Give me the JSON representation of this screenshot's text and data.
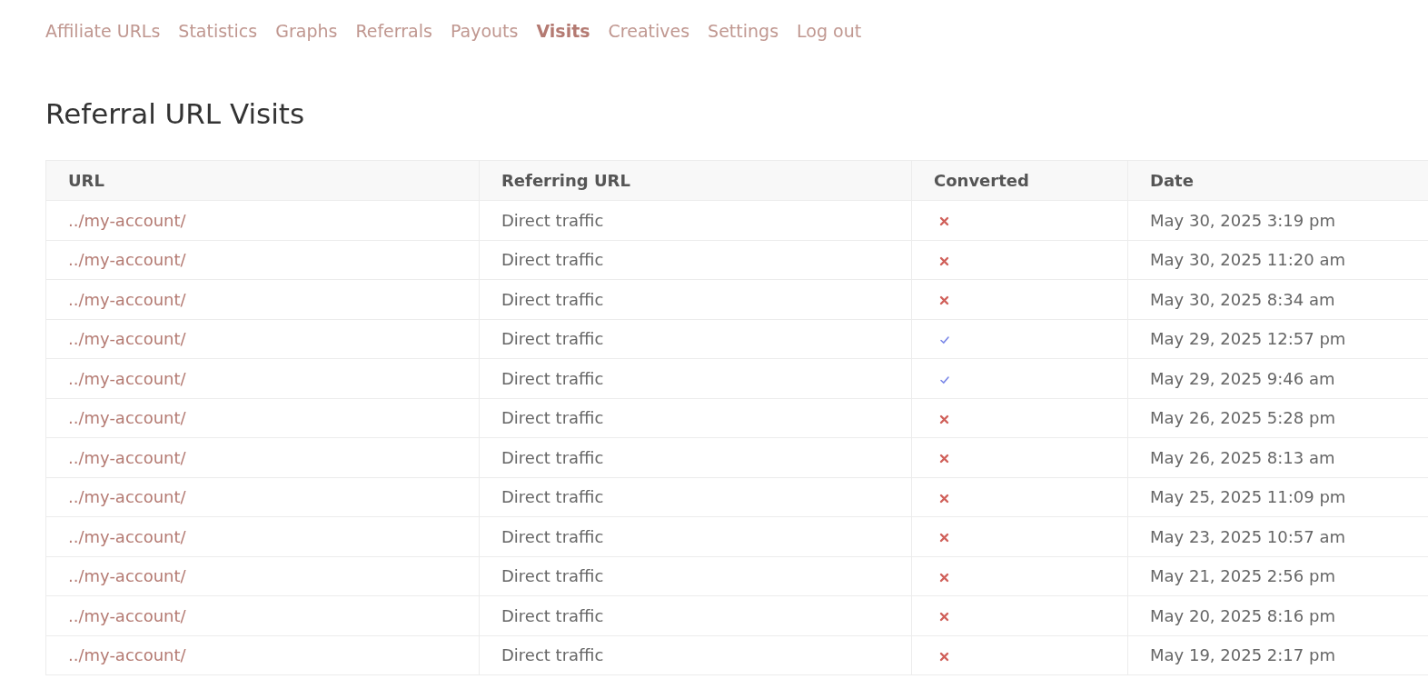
{
  "nav": [
    {
      "label": "Affiliate URLs",
      "selected": false
    },
    {
      "label": "Statistics",
      "selected": false
    },
    {
      "label": "Graphs",
      "selected": false
    },
    {
      "label": "Referrals",
      "selected": false
    },
    {
      "label": "Payouts",
      "selected": false
    },
    {
      "label": "Visits",
      "selected": true
    },
    {
      "label": "Creatives",
      "selected": false
    },
    {
      "label": "Settings",
      "selected": false
    },
    {
      "label": "Log out",
      "selected": false
    }
  ],
  "heading": "Referral URL Visits",
  "table": {
    "columns": [
      "URL",
      "Referring URL",
      "Converted",
      "Date"
    ],
    "rows": [
      {
        "url": "../my-account/",
        "referrer": "Direct traffic",
        "converted": false,
        "date": "May 30, 2025 3:19 pm"
      },
      {
        "url": "../my-account/",
        "referrer": "Direct traffic",
        "converted": false,
        "date": "May 30, 2025 11:20 am"
      },
      {
        "url": "../my-account/",
        "referrer": "Direct traffic",
        "converted": false,
        "date": "May 30, 2025 8:34 am"
      },
      {
        "url": "../my-account/",
        "referrer": "Direct traffic",
        "converted": true,
        "date": "May 29, 2025 12:57 pm"
      },
      {
        "url": "../my-account/",
        "referrer": "Direct traffic",
        "converted": true,
        "date": "May 29, 2025 9:46 am"
      },
      {
        "url": "../my-account/",
        "referrer": "Direct traffic",
        "converted": false,
        "date": "May 26, 2025 5:28 pm"
      },
      {
        "url": "../my-account/",
        "referrer": "Direct traffic",
        "converted": false,
        "date": "May 26, 2025 8:13 am"
      },
      {
        "url": "../my-account/",
        "referrer": "Direct traffic",
        "converted": false,
        "date": "May 25, 2025 11:09 pm"
      },
      {
        "url": "../my-account/",
        "referrer": "Direct traffic",
        "converted": false,
        "date": "May 23, 2025 10:57 am"
      },
      {
        "url": "../my-account/",
        "referrer": "Direct traffic",
        "converted": false,
        "date": "May 21, 2025 2:56 pm"
      },
      {
        "url": "../my-account/",
        "referrer": "Direct traffic",
        "converted": false,
        "date": "May 20, 2025 8:16 pm"
      },
      {
        "url": "../my-account/",
        "referrer": "Direct traffic",
        "converted": false,
        "date": "May 19, 2025 2:17 pm"
      }
    ]
  }
}
